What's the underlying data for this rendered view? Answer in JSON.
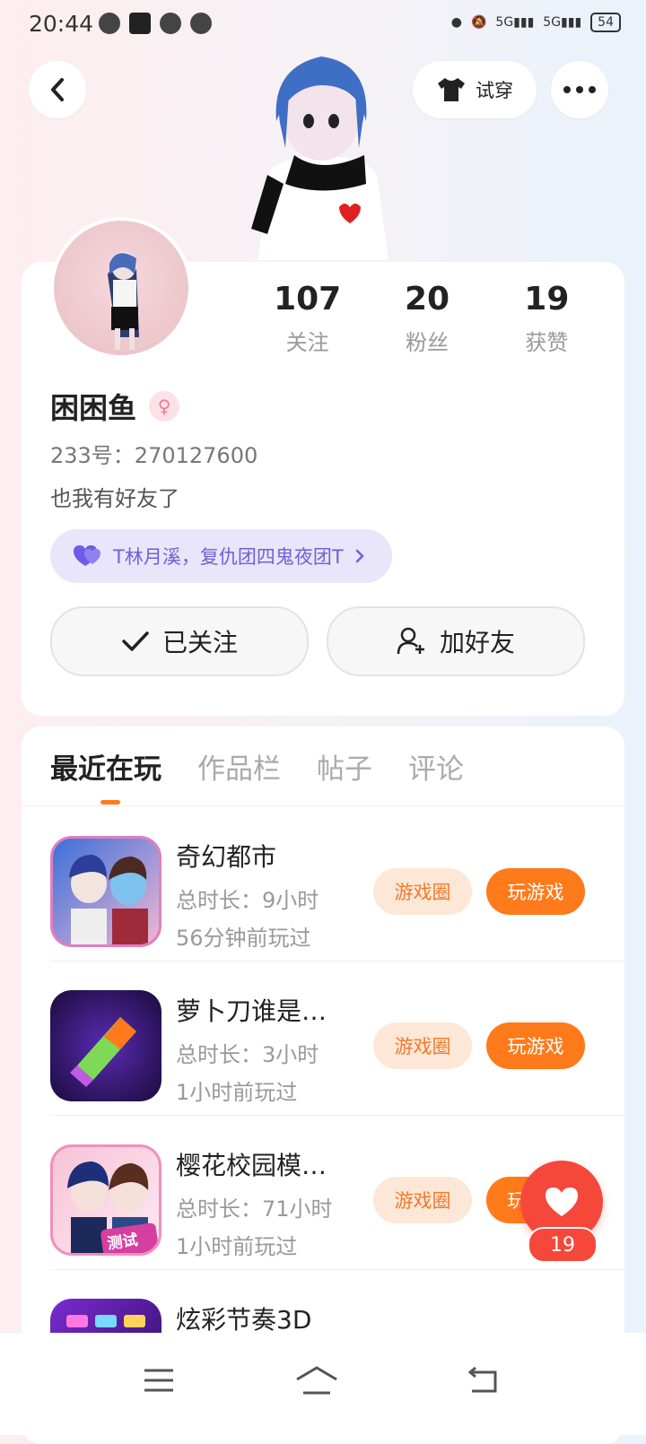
{
  "status_bar": {
    "time": "20:44",
    "battery": "54"
  },
  "header": {
    "tryon_label": "试穿"
  },
  "profile": {
    "stats": [
      {
        "num": "107",
        "label": "关注"
      },
      {
        "num": "20",
        "label": "粉丝"
      },
      {
        "num": "19",
        "label": "获赞"
      }
    ],
    "name": "困困鱼",
    "uid": "233号：270127600",
    "bio": "也我有好友了",
    "guild": "T林月溪，复仇团四鬼夜团T",
    "followed_label": "已关注",
    "add_friend_label": "加好友"
  },
  "tabs": [
    "最近在玩",
    "作品栏",
    "帖子",
    "评论"
  ],
  "games": [
    {
      "name": "奇幻都市",
      "time": "总时长：9小时",
      "last": "56分钟前玩过"
    },
    {
      "name": "萝卜刀谁是…",
      "time": "总时长：3小时",
      "last": "1小时前玩过"
    },
    {
      "name": "樱花校园模…",
      "time": "总时长：71小时",
      "last": "1小时前玩过"
    },
    {
      "name": "炫彩节奏3D",
      "time": "",
      "last": ""
    }
  ],
  "buttons": {
    "circle": "游戏圈",
    "play": "玩游戏",
    "test_badge": "测试版"
  },
  "like_count": "19",
  "colors": {
    "accent": "#ff7a1a",
    "like": "#f5483a",
    "guild": "#7060d8"
  }
}
